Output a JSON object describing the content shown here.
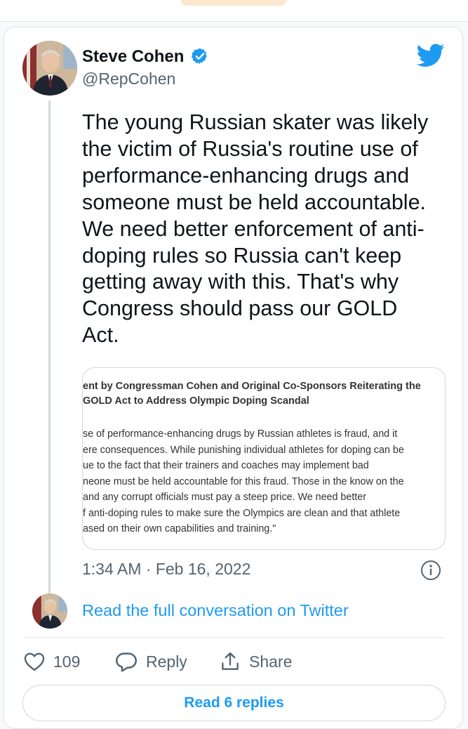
{
  "author": {
    "name": "Steve Cohen",
    "handle": "@RepCohen",
    "verified": true
  },
  "tweet": {
    "text_lines": [
      "The young Russian skater was likely",
      "the victim of Russia's routine use of",
      "performance-enhancing drugs and",
      "someone must be held accountable.",
      "We need better enforcement of anti-",
      "doping rules so Russia can't keep",
      "getting away with this. That's why",
      "Congress should pass our GOLD",
      "Act."
    ],
    "timestamp": "1:34 AM · Feb 16, 2022"
  },
  "quote_image": {
    "title_lines": [
      "ent by Congressman Cohen and Original Co-Sponsors Reiterating the",
      "GOLD Act to Address Olympic Doping Scandal"
    ],
    "body_lines": [
      "se of performance-enhancing drugs by Russian athletes is fraud, and it",
      "ere consequences. While punishing individual athletes for doping can be",
      "ue to the fact that their trainers and coaches may implement bad",
      "neone must be held accountable for this fraud. Those in the know on the",
      "and any corrupt officials must pay a steep price. We need better",
      "f anti-doping rules to make sure the Olympics are clean and that athlete",
      "ased on their own capabilities and training.\""
    ]
  },
  "conversation_link": "Read the full conversation on Twitter",
  "actions": {
    "like_count": "109",
    "reply_label": "Reply",
    "share_label": "Share"
  },
  "replies_button": "Read 6 replies",
  "colors": {
    "accent": "#1d9bf0",
    "text": "#0f1419",
    "secondary": "#536471",
    "border": "#cfd9de"
  },
  "icons": [
    "verified-badge-icon",
    "twitter-bird-icon",
    "info-icon",
    "heart-icon",
    "reply-icon",
    "share-icon"
  ]
}
